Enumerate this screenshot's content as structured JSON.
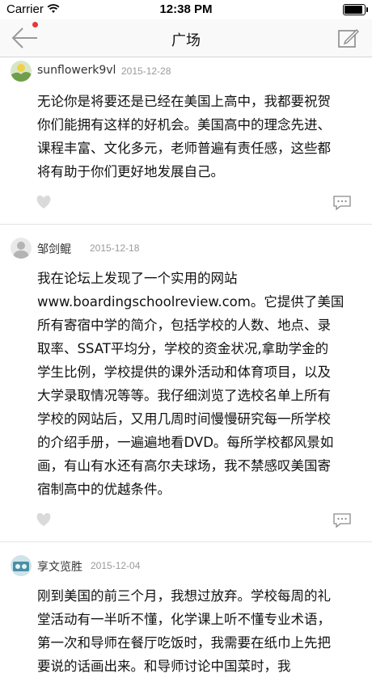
{
  "status_bar": {
    "carrier": "Carrier",
    "time": "12:38 PM"
  },
  "nav": {
    "title": "广场"
  },
  "posts": [
    {
      "username": "sunflowerk9vl",
      "date": "2015-12-28",
      "text": "无论你是将要还是已经在美国上高中，我都要祝贺\n你们能拥有这样的好机会。美国高中的理念先进、\n课程丰富、文化多元，老师普遍有责任感，这些都\n将有助于你们更好地发展自己。"
    },
    {
      "username": "邹剑鲲",
      "date": "2015-12-18",
      "text": "我在论坛上发现了一个实用的网站\nwww.boardingschoolreview.com。它提供了美国\n所有寄宿中学的简介，包括学校的人数、地点、录\n取率、SSAT平均分，学校的资金状况,拿助学金的\n学生比例，学校提供的课外活动和体育项目，以及\n大学录取情况等等。我仔细浏览了选校名单上所有\n学校的网站后，又用几周时间慢慢研究每一所学校\n的介绍手册，一遍遍地看DVD。每所学校都风景如\n画，有山有水还有高尔夫球场，我不禁感叹美国寄\n宿制高中的优越条件。"
    },
    {
      "username": "享文览胜",
      "date": "2015-12-04",
      "text": "刚到美国的前三个月，我想过放弃。学校每周的礼\n堂活动有一半听不懂，化学课上听不懂专业术语，\n第一次和导师在餐厅吃饭时，我需要在纸巾上先把\n要说的话画出来。和导师讨论中国菜时，我"
    }
  ]
}
